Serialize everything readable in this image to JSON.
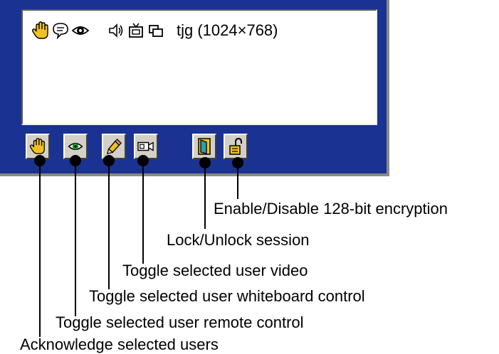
{
  "user_list": {
    "user_name": "tjg (1024×768)",
    "row_icons": [
      "hand-icon",
      "speech-bubble-icon",
      "eye-icon",
      "speaker-icon",
      "video-camera-icon",
      "window-icon"
    ]
  },
  "toolbar": {
    "buttons": [
      {
        "icon": "hand-icon"
      },
      {
        "icon": "eye-icon"
      },
      {
        "icon": "pencil-icon"
      },
      {
        "icon": "video-camera-icon"
      },
      {
        "icon": "door-icon"
      },
      {
        "icon": "padlock-icon"
      }
    ]
  },
  "callouts": {
    "acknowledge": "Acknowledge selected users",
    "remote_control": "Toggle selected user remote control",
    "whiteboard": "Toggle selected user whiteboard control",
    "video": "Toggle selected user video",
    "lock_session": "Lock/Unlock session",
    "encryption": "Enable/Disable 128-bit encryption"
  },
  "colors": {
    "panel_background": "#1a3291",
    "button_face": "#d4d0c8",
    "list_background": "#ffffff"
  }
}
